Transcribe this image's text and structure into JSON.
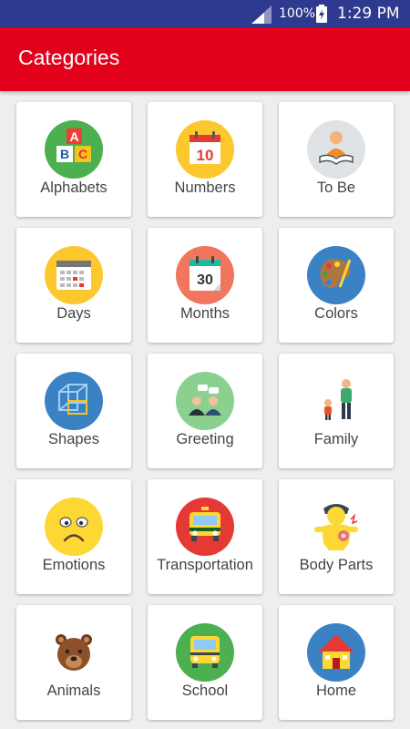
{
  "status_bar": {
    "battery": "100%",
    "time": "1:29 PM"
  },
  "app_bar": {
    "title": "Categories"
  },
  "colors": {
    "app_bar": "#e2001a",
    "status_bar": "#2e3a8f",
    "background": "#eeeeee"
  },
  "categories": [
    {
      "label": "Alphabets",
      "icon": "alphabet-blocks-icon"
    },
    {
      "label": "Numbers",
      "icon": "calendar-10-icon"
    },
    {
      "label": "To Be",
      "icon": "reader-icon"
    },
    {
      "label": "Days",
      "icon": "calendar-grid-icon"
    },
    {
      "label": "Months",
      "icon": "calendar-30-icon"
    },
    {
      "label": "Colors",
      "icon": "palette-icon"
    },
    {
      "label": "Shapes",
      "icon": "cube-icon"
    },
    {
      "label": "Greeting",
      "icon": "people-talking-icon"
    },
    {
      "label": "Family",
      "icon": "family-icon"
    },
    {
      "label": "Emotions",
      "icon": "sad-face-icon"
    },
    {
      "label": "Transportation",
      "icon": "taxi-icon"
    },
    {
      "label": "Body Parts",
      "icon": "body-icon"
    },
    {
      "label": "Animals",
      "icon": "bear-icon"
    },
    {
      "label": "School",
      "icon": "school-bus-icon"
    },
    {
      "label": "Home",
      "icon": "house-icon"
    }
  ]
}
